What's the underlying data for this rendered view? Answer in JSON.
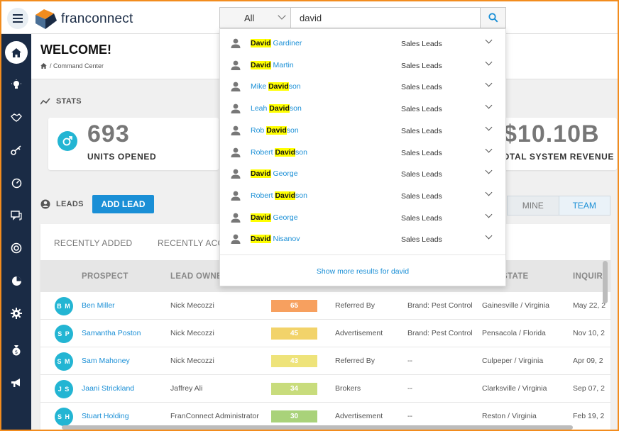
{
  "app": {
    "logo_text": "franconnect"
  },
  "search": {
    "category": "All",
    "value": "david",
    "placeholder": ""
  },
  "page": {
    "title": "WELCOME!",
    "breadcrumb": "/ Command Center"
  },
  "stats": {
    "title": "STATS",
    "cards": [
      {
        "value": "693",
        "label": "UNITS OPENED"
      },
      {
        "value": "$10.10B",
        "label": "OTAL SYSTEM REVENUE"
      }
    ]
  },
  "leads": {
    "title": "LEADS",
    "add_label": "ADD LEAD",
    "toggle": {
      "mine": "MINE",
      "team": "TEAM"
    },
    "subtabs": [
      "RECENTLY ADDED",
      "RECENTLY ACC"
    ],
    "columns": [
      "PROSPECT",
      "LEAD OWNE",
      "STATE",
      "INQUIR"
    ],
    "rows": [
      {
        "initials": "B M",
        "name": "Ben Miller",
        "owner": "Nick Mecozzi",
        "score": "65",
        "score_color": "#f7a05f",
        "source": "Referred By",
        "brand": "Brand: Pest Control",
        "location": "Gainesville / Virginia",
        "date": "May 22, 2"
      },
      {
        "initials": "S P",
        "name": "Samantha Poston",
        "owner": "Nick Mecozzi",
        "score": "45",
        "score_color": "#f2d36a",
        "source": "Advertisement",
        "brand": "Brand: Pest Control",
        "location": "Pensacola / Florida",
        "date": "Nov 10, 2"
      },
      {
        "initials": "S M",
        "name": "Sam Mahoney",
        "owner": "Nick Mecozzi",
        "score": "43",
        "score_color": "#eee37a",
        "source": "Referred By",
        "brand": "--",
        "location": "Culpeper / Virginia",
        "date": "Apr 09, 2"
      },
      {
        "initials": "J S",
        "name": "Jaani Strickland",
        "owner": "Jaffrey Ali",
        "score": "34",
        "score_color": "#c8dc7c",
        "source": "Brokers",
        "brand": "--",
        "location": "Clarksville / Virginia",
        "date": "Sep 07, 2"
      },
      {
        "initials": "S H",
        "name": "Stuart Holding",
        "owner": "FranConnect Administrator",
        "score": "30",
        "score_color": "#a9d27a",
        "source": "Advertisement",
        "brand": "--",
        "location": "Reston / Virginia",
        "date": "Feb 19, 2"
      }
    ]
  },
  "dropdown": {
    "items": [
      {
        "pre": "",
        "hl": "David",
        "post": " Gardiner",
        "module": "Sales Leads"
      },
      {
        "pre": "",
        "hl": "David",
        "post": " Martin",
        "module": "Sales Leads"
      },
      {
        "pre": "Mike ",
        "hl": "David",
        "post": "son",
        "module": "Sales Leads"
      },
      {
        "pre": "Leah ",
        "hl": "David",
        "post": "son",
        "module": "Sales Leads"
      },
      {
        "pre": "Rob ",
        "hl": "David",
        "post": "son",
        "module": "Sales Leads"
      },
      {
        "pre": "Robert ",
        "hl": "David",
        "post": "son",
        "module": "Sales Leads"
      },
      {
        "pre": "",
        "hl": "David",
        "post": " George",
        "module": "Sales Leads"
      },
      {
        "pre": "Robert ",
        "hl": "David",
        "post": "son",
        "module": "Sales Leads"
      },
      {
        "pre": "",
        "hl": "David",
        "post": " George",
        "module": "Sales Leads"
      },
      {
        "pre": "",
        "hl": "David",
        "post": " Nisanov",
        "module": "Sales Leads"
      }
    ],
    "more": "Show more results for david"
  },
  "sidebar": {
    "items": [
      "home-icon",
      "lightbulb-icon",
      "handshake-icon",
      "key-icon",
      "dashboard-icon",
      "chat-icon",
      "lifebuoy-icon",
      "pie-icon",
      "gear-icon",
      "money-bag-icon",
      "megaphone-icon"
    ]
  }
}
